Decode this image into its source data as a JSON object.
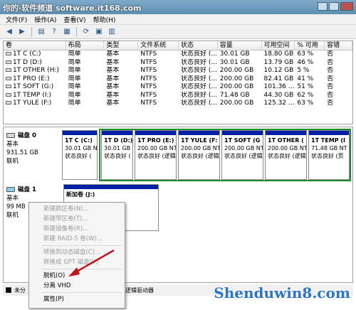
{
  "title": "你的·软件频道 software.it168.com",
  "menu": [
    "文件(F)",
    "操作(A)",
    "查看(V)",
    "帮助(H)"
  ],
  "table": {
    "headers": [
      "卷",
      "布局",
      "类型",
      "文件系统",
      "状态",
      "容量",
      "可用空间",
      "% 可用",
      "容错"
    ],
    "rows": [
      [
        "1T C (C:)",
        "简单",
        "基本",
        "NTFS",
        "状态良好 (...",
        "30.01 GB",
        "18.80 GB",
        "63 %",
        "否"
      ],
      [
        "1T D (D:)",
        "简单",
        "基本",
        "NTFS",
        "状态良好 (...",
        "30.01 GB",
        "13.79 GB",
        "46 %",
        "否"
      ],
      [
        "1T OTHER (H:)",
        "简单",
        "基本",
        "NTFS",
        "状态良好 (...",
        "200.00 GB",
        "10.12 GB",
        "5 %",
        "否"
      ],
      [
        "1T PRO (E:)",
        "简单",
        "基本",
        "NTFS",
        "状态良好 (...",
        "200.00 GB",
        "82.41 GB",
        "41 %",
        "否"
      ],
      [
        "1T SOFT (G:)",
        "简单",
        "基本",
        "NTFS",
        "状态良好 (...",
        "200.00 GB",
        "101.36 ...",
        "51 %",
        "否"
      ],
      [
        "1T TEMP (I:)",
        "简单",
        "基本",
        "NTFS",
        "状态良好 (...",
        "71.48 GB",
        "44.30 GB",
        "62 %",
        "否"
      ],
      [
        "1T YULE (F:)",
        "简单",
        "基本",
        "NTFS",
        "状态良好 (...",
        "200.00 GB",
        "125.32 ...",
        "63 %",
        "否"
      ]
    ]
  },
  "disk0": {
    "name": "磁盘 0",
    "type": "基本",
    "size": "931.51 GB",
    "status": "联机",
    "partitions": [
      {
        "label": "1T C (C:)",
        "size": "30.01 GB N",
        "status": "状态良好 ("
      },
      {
        "label": "1T D  (D:)",
        "size": "30.01 GB N",
        "status": "状态良好 ("
      },
      {
        "label": "1T PRO  (E:)",
        "size": "200.00 GB NT",
        "status": "状态良好 (逻辑"
      },
      {
        "label": "1T YULE  (F:",
        "size": "200.00 GB NT",
        "status": "状态良好 (逻辑"
      },
      {
        "label": "1T SOFT  (G",
        "size": "200.00 GB NT",
        "status": "状态良好 (逻辑"
      },
      {
        "label": "1T OTHER  (",
        "size": "200.00 GB NT",
        "status": "状态良好 (逻辑"
      },
      {
        "label": "1T TEMP  (I",
        "size": "71.48 GB NT",
        "status": "状态良好 (页"
      }
    ]
  },
  "disk1": {
    "name": "磁盘 1",
    "type": "基本",
    "size": "99 MB",
    "status": "联机",
    "partition": {
      "label": "新加卷 (J:)"
    }
  },
  "context_menu": {
    "items": [
      {
        "label": "新建跨区卷(N)...",
        "enabled": false
      },
      {
        "label": "新建带区卷(T)...",
        "enabled": false
      },
      {
        "label": "新建镜像卷(R)...",
        "enabled": false
      },
      {
        "label": "新建 RAID-5 卷(W)...",
        "enabled": false
      },
      {
        "label": "转换到动态磁盘(C)...",
        "enabled": false
      },
      {
        "label": "转换成 GPT 磁盘(V)",
        "enabled": false
      },
      {
        "label": "脱机(O)",
        "enabled": true
      },
      {
        "label": "分离 VHD",
        "enabled": true
      },
      {
        "label": "属性(P)",
        "enabled": true
      }
    ]
  },
  "legend": {
    "unallocated": "未分",
    "logical": "逻辑驱动器"
  },
  "watermark": "Shenduwin8.com",
  "colors": {
    "primary_partition_bar": "#0020a8",
    "extended_frame": "#1e8a2e",
    "arrow": "#c0141c"
  }
}
